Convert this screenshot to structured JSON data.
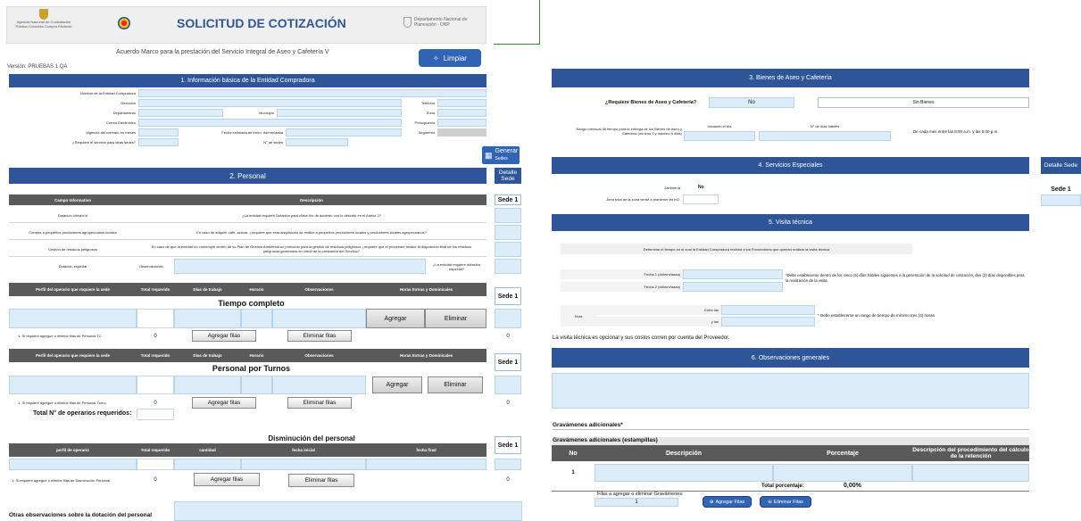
{
  "header": {
    "agency_logo_text": "Agencia Nacional de Contratación Pública Colombia Compra Eficiente",
    "title": "SOLICITUD DE COTIZACIÓN",
    "dnp_logo_text": "Departamento Nacional de Planeación · DNP",
    "subtitle": "Acuerdo Marco para la prestación del Servicio Integral de Aseo y Cafetería V",
    "version": "Versión: PRUEBAS 1 QA",
    "limpiar": "Limpiar",
    "generar": "Generar",
    "generar_sub": "Sedes"
  },
  "s1": {
    "title": "1. Información básica de la Entidad Compradora",
    "nombre": "Nombre de la Entidad Compradora",
    "direccion": "Dirección",
    "telefono": "Teléfono",
    "departamento": "Departamento",
    "municipio": "Municipio",
    "zona": "Zona",
    "correo": "Correo Electrónico",
    "presupuesto": "Presupuesto",
    "vigencia": "Vigencia del contrato en meses",
    "fecha_inicio": "Fecha estimada de inicio: dd/mm/aaaa",
    "segmento": "Segmento",
    "requiere_sedes": "¿Requiere el servicio para otras sedes?",
    "n_sedes": "N° de sedes"
  },
  "s2": {
    "title": "2. Personal",
    "detalle": "Detalle Sede",
    "campo": "Campo Informativo",
    "descripcion": "Descripción",
    "sede1": "Sede 1",
    "rows": [
      {
        "label": "Dotación clima frío",
        "desc": "¿La entidad requiere Dotación para clima frío de acuerdo con lo descrito en el Anexo 2?"
      },
      {
        "label": "Compra a pequeños productores agropecuarios locales",
        "desc": "En caso de adquirir café, azúcar, ¿requiere que esta adquisición se realice a pequeños productores locales y productores locales agropecuarios?"
      },
      {
        "label": "Gestión de residuos peligrosos",
        "desc": "En caso de que la entidad no contemple dentro de su Plan de Gestión Ambiental un protocolo para la gestión de residuos peligrosos ¿requiere que el proveedor realice la disposición final de los residuos peligrosos generados en virtud de la prestación del Servicio?"
      }
    ],
    "dotacion_especial": "Dotación especial",
    "observaciones": "Observaciones:",
    "dotacion_q": "¿La entidad requiere dotación especial?",
    "tc_head": [
      "Perfil del operario que requiere la sede",
      "Total requerido",
      "Días de trabajo",
      "Horario",
      "Observaciones",
      "Horas Extras y Dominicales"
    ],
    "tiempo_completo": "Tiempo completo",
    "agregar": "Agregar",
    "eliminar": "Eliminar",
    "tc_note": "1. Si requiere agregue o elimine filas de Personal TC",
    "zero": "0",
    "agregar_filas": "Agregar filas",
    "eliminar_filas": "Eliminar filas",
    "turnos": "Personal por Turnos",
    "turnos_note": "1. Si requiere agregue o elimine filas de Personal Turno",
    "total_operarios": "Total N° de operarios requeridos:",
    "disminucion": "Disminución del personal",
    "dis_head": [
      "perfil de operario",
      "Total requerido",
      "cantidad",
      "fecha inicial",
      "fecha final"
    ],
    "dis_note": "1. Si requiere agregue o elimine filas de Disminución Personal",
    "otras_obs": "Otras observaciones sobre la dotación del personal"
  },
  "s3": {
    "title": "3. Bienes de Aseo y Cafetería",
    "requiere": "¿Requiere Bienes de Aseo y Cafetería?",
    "no": "No",
    "sin_bienes": "Sin Bienes",
    "rango": "Rango mensual de tiempo para la entrega de los Bienes de Aseo y Cafetería (mínimo 3 y máximo 5 días)",
    "iniciando": "Iniciando el día",
    "n_dias": "N° de días hábiles",
    "horario": "De cada mes entre las 8:00 a.m. y las 5:00 p.m."
  },
  "s4": {
    "title": "4. Servicios Especiales",
    "detalle": "Detalle Sede",
    "jardineria": "Jardinería",
    "no": "No",
    "area": "Área total de la zona verde a mantener en m2:",
    "sede1": "Sede 1"
  },
  "s5": {
    "title": "5. Visita técnica",
    "determine": "Determine el tiempo en el cual la Entidad Compradora recibirá a los Proveedores que quieran realizar la visita técnica",
    "fecha1": "Fecha 1 (dd/mm/aaaa)",
    "fecha2": "Fecha 2 (dd/mm/aaaa)",
    "fecha_note": "*Debe establecerse dentro de los cinco (5) días hábiles siguientes a la generación de la solicitud de cotización, dos (2) días disponibles para la realización de la visita.",
    "hora": "Hora",
    "entre": "Entre las",
    "yla": "y las",
    "hora_note": "* Debe establecerse un rango de tiempo de mínimo tres (3) horas",
    "opcional": "La visita técnica es opcional y sus costos corren por cuenta del Proveedor."
  },
  "s6": {
    "title": "6. Observaciones generales",
    "grav_title": "Gravámenes adicionales*",
    "grav_sub": "Gravámenes adicionales (estampillas)",
    "cols": [
      "No",
      "Descripción",
      "Porcentaje",
      "Descripción del procedimiento del cálculo de la retención"
    ],
    "row_no": "1",
    "total_label": "Total porcentaje:",
    "total_value": "0,00%",
    "filas_label": "Filas a agregar o eliminar Gravámenes:",
    "filas_value": "1",
    "agregar": "Agregar Filas",
    "eliminar": "Eliminar Filas"
  },
  "colors": {
    "band": "#2e5597",
    "input": "#dcecf8",
    "gray": "#5a5a5a"
  }
}
